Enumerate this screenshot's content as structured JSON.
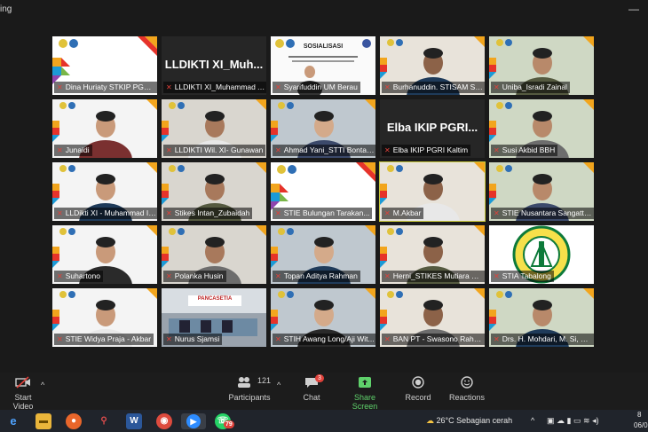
{
  "window": {
    "title_fragment": "ing",
    "minimize_icon": "minimize-icon"
  },
  "tiles": [
    {
      "label": "Dina Huriaty STKIP PGRI ...",
      "type": "logo"
    },
    {
      "label": "LLDIKTI XI_Muhammad A...",
      "type": "text",
      "big": "LLDIKTI XI_Muh..."
    },
    {
      "label": "Syarifuddin UM Berau",
      "type": "slide",
      "slide_title": "SOSIALISASI"
    },
    {
      "label": "Burhanuddin. STISAM SA...",
      "type": "person"
    },
    {
      "label": "Uniba_Isradi Zainal",
      "type": "person"
    },
    {
      "label": "Junaidi",
      "type": "person"
    },
    {
      "label": "LLDIKTI Wil. XI- Gunawan",
      "type": "person"
    },
    {
      "label": "Ahmad Yani_STTI Bontang",
      "type": "person"
    },
    {
      "label": "Elba IKIP PGRI Kaltim",
      "type": "text",
      "big": "Elba IKIP PGRI..."
    },
    {
      "label": "Susi Akbid BBH",
      "type": "person"
    },
    {
      "label": "LLDikti XI - Muhammad Is...",
      "type": "person"
    },
    {
      "label": "Stikes Intan_Zubaidah",
      "type": "person"
    },
    {
      "label": "STIE Bulungan Tarakan...",
      "type": "logo"
    },
    {
      "label": "M.Akbar",
      "type": "person",
      "active": true
    },
    {
      "label": "STIE Nusantara Sangatta...",
      "type": "person"
    },
    {
      "label": "Suhartono",
      "type": "person"
    },
    {
      "label": "Polanka Husin",
      "type": "person"
    },
    {
      "label": "Topan Aditya Rahman",
      "type": "person"
    },
    {
      "label": "Herni_STIKES Mutiara Ma...",
      "type": "person"
    },
    {
      "label": "STIA Tabalong",
      "type": "seal"
    },
    {
      "label": "STIE Widya Praja - Akbar",
      "type": "person"
    },
    {
      "label": "Nurus Sjamsi",
      "type": "building",
      "sign": "PANCASETIA"
    },
    {
      "label": "STIH Awang Long/Aji Wit...",
      "type": "person"
    },
    {
      "label": "BAN PT - Swasono Rahar...",
      "type": "person"
    },
    {
      "label": "Drs. H. Mohdari, M. Si, SP...",
      "type": "person"
    }
  ],
  "controls": {
    "start_video": "Start Video",
    "participants": "Participants",
    "participants_count": "121",
    "chat": "Chat",
    "chat_badge": "3",
    "share_screen": "Share Screen",
    "record": "Record",
    "reactions": "Reactions"
  },
  "taskbar": {
    "whatsapp_badge": "79",
    "weather_temp": "26°C",
    "weather_text": "Sebagian cerah",
    "date_fragment": "06/0",
    "time_fragment": "8"
  },
  "colors": {
    "share_green": "#5fd16b",
    "mute_red": "#e0413a",
    "active_outline": "#c9c93a"
  }
}
